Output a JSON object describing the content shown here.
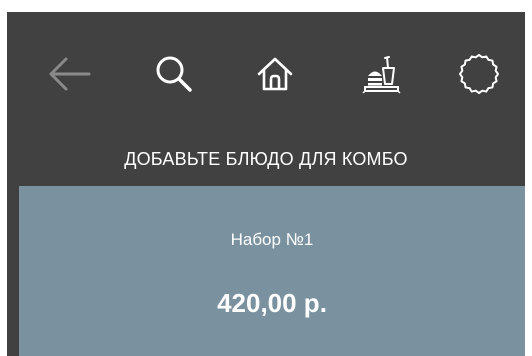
{
  "toolbar": {
    "icons": [
      "back-arrow-icon",
      "search-icon",
      "home-icon",
      "combo-meal-icon",
      "settings-icon"
    ]
  },
  "heading": "ДОБАВЬТЕ БЛЮДО ДЛЯ КОМБО",
  "combo": {
    "name": "Набор №1",
    "price": "420,00 р."
  },
  "colors": {
    "background": "#414141",
    "card": "#7a929f",
    "icon": "#ffffff",
    "icon_disabled": "#8a8a8a"
  }
}
